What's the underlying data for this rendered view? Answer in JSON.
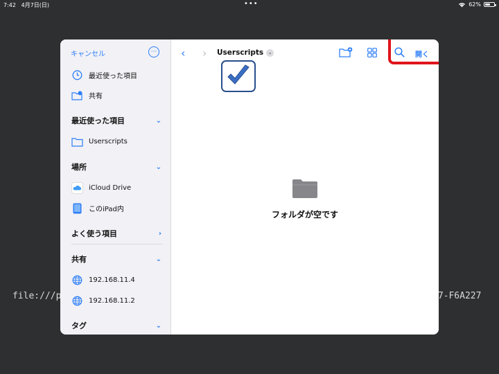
{
  "status_bar": {
    "time": "7:42",
    "date": "4月7日(日)",
    "battery": "62%",
    "battery_level": 0.62
  },
  "background": {
    "url_left": "file:///p",
    "url_right": "A7-F6A227"
  },
  "sidebar": {
    "cancel_label": "キャンセル",
    "top_items": [
      {
        "label": "最近使った項目",
        "icon": "clock-icon"
      },
      {
        "label": "共有",
        "icon": "shared-folder-icon"
      }
    ],
    "sections": [
      {
        "title": "最近使った項目",
        "items": [
          {
            "label": "Userscripts",
            "icon": "folder-icon"
          }
        ]
      },
      {
        "title": "場所",
        "items": [
          {
            "label": "iCloud Drive",
            "icon": "icloud-icon"
          },
          {
            "label": "このiPad内",
            "icon": "ipad-icon"
          }
        ]
      },
      {
        "title": "よく使う項目",
        "items": []
      },
      {
        "title": "共有",
        "items": [
          {
            "label": "192.168.11.4",
            "icon": "globe-icon"
          },
          {
            "label": "192.168.11.2",
            "icon": "globe-icon"
          }
        ]
      },
      {
        "title": "タグ",
        "items": []
      }
    ]
  },
  "toolbar": {
    "breadcrumb": "Userscripts",
    "open_label": "開く"
  },
  "main": {
    "empty_message": "フォルダが空です"
  },
  "colors": {
    "accent": "#2c7ef7",
    "highlight": "#e0141b",
    "checkbox_blue": "#3b6fc5"
  }
}
